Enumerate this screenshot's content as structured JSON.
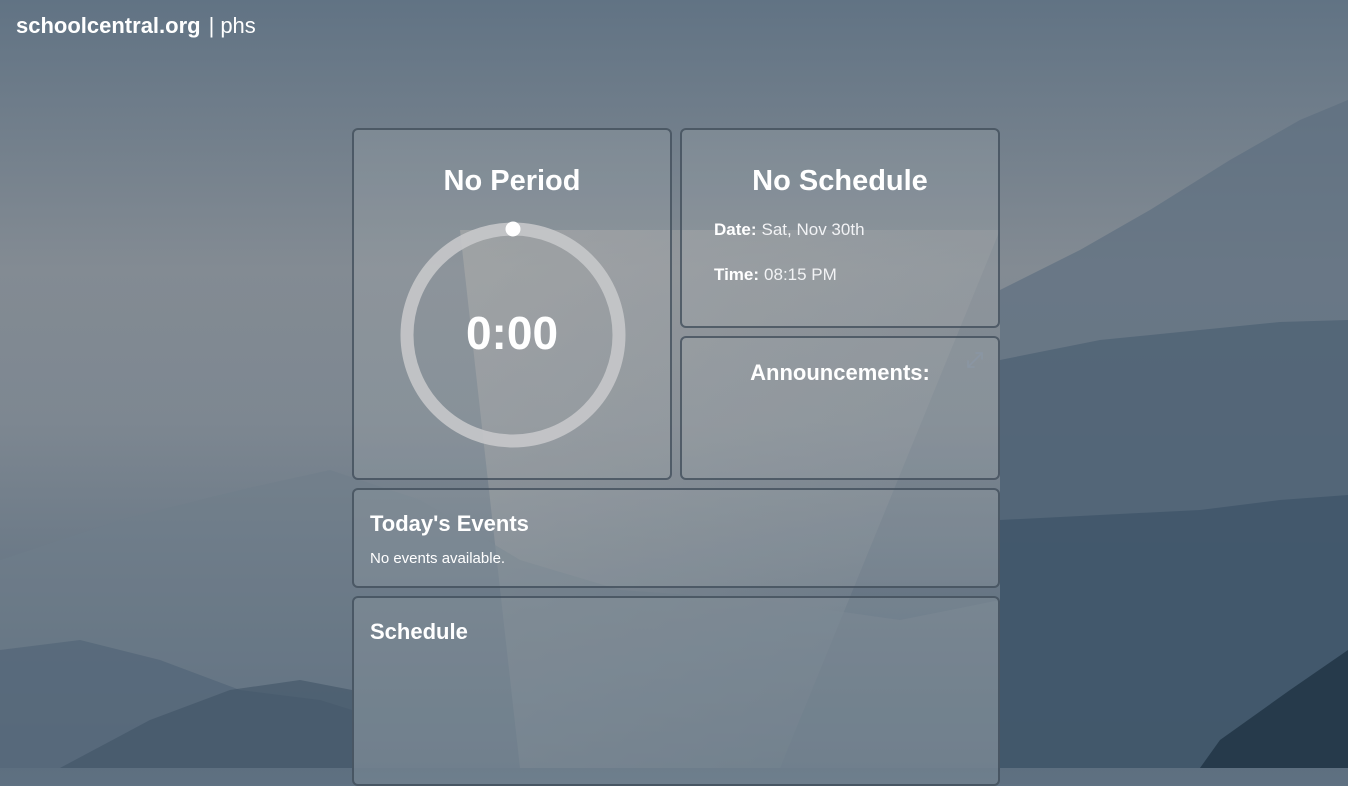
{
  "header": {
    "site_name": "schoolcentral.org",
    "separator": "|",
    "school": "phs"
  },
  "period_card": {
    "title": "No Period",
    "timer": "0:00",
    "progress": 0
  },
  "schedule_info": {
    "title": "No Schedule",
    "date_label": "Date:",
    "date_value": "Sat, Nov 30th",
    "time_label": "Time:",
    "time_value": "08:15 PM"
  },
  "announcements": {
    "title": "Announcements:",
    "expand_icon": "expand-icon"
  },
  "events": {
    "title": "Today's Events",
    "empty_text": "No events available."
  },
  "schedule": {
    "title": "Schedule"
  },
  "colors": {
    "text": "#ffffff",
    "ring": "#c7c8ca",
    "card_border": "#3c4856"
  }
}
